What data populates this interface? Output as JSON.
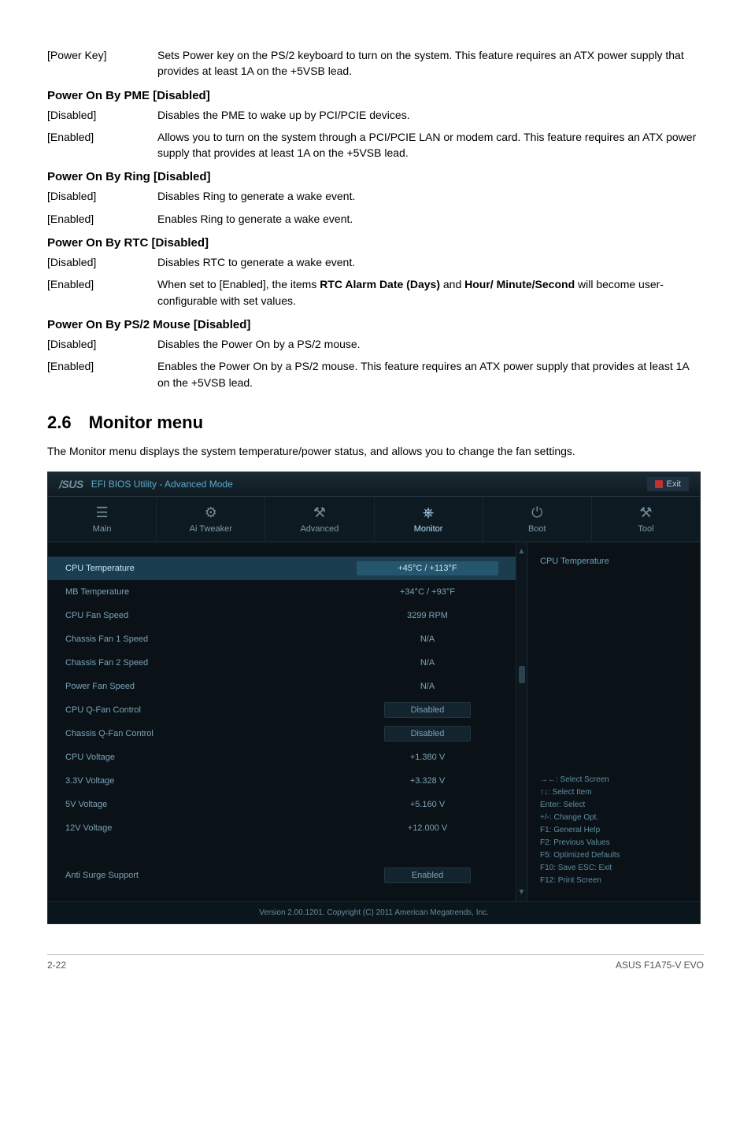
{
  "top_rows": [
    {
      "key": "[Power Key]",
      "desc": "Sets Power key on the PS/2 keyboard to turn on the system. This feature requires an ATX power supply that provides at least 1A on the +5VSB lead."
    }
  ],
  "sections": [
    {
      "heading": "Power On By PME [Disabled]",
      "rows": [
        {
          "key": "[Disabled]",
          "desc": "Disables the PME to wake up by PCI/PCIE devices."
        },
        {
          "key": "[Enabled]",
          "desc": "Allows you to turn on the system through a PCI/PCIE LAN or modem card. This feature requires an ATX power supply that provides at least 1A on the +5VSB lead."
        }
      ]
    },
    {
      "heading": "Power On By Ring [Disabled]",
      "rows": [
        {
          "key": "[Disabled]",
          "desc": "Disables Ring to generate a wake event."
        },
        {
          "key": "[Enabled]",
          "desc": "Enables Ring to generate a wake event."
        }
      ]
    },
    {
      "heading": "Power On By RTC [Disabled]",
      "rows": [
        {
          "key": "[Disabled]",
          "desc": "Disables RTC to generate a wake event."
        },
        {
          "key": "[Enabled]",
          "desc_html": "When set to [Enabled], the items <b>RTC Alarm Date (Days)</b> and <b>Hour/ Minute/Second</b> will become user-configurable with set values."
        }
      ]
    },
    {
      "heading": "Power On By PS/2 Mouse [Disabled]",
      "rows": [
        {
          "key": "[Disabled]",
          "desc": "Disables the Power On by a PS/2 mouse."
        },
        {
          "key": "[Enabled]",
          "desc": "Enables the Power On by a PS/2 mouse. This feature requires an ATX power supply that provides at least 1A on the +5VSB lead."
        }
      ]
    }
  ],
  "monitor_section": {
    "title": "2.6 Monitor menu",
    "desc": "The Monitor menu displays the system temperature/power status, and allows you to change the fan settings."
  },
  "bios": {
    "brand": "/SUS",
    "title": "EFI BIOS Utility - Advanced Mode",
    "exit": "Exit",
    "tabs": [
      {
        "icon": "☰",
        "label": "Main"
      },
      {
        "icon": "⚙",
        "label": "Ai Tweaker"
      },
      {
        "icon": "⚒",
        "label": "Advanced"
      },
      {
        "icon": "⎈",
        "label": "Monitor",
        "active": true
      },
      {
        "icon": "⏻",
        "label": "Boot"
      },
      {
        "icon": "⚒",
        "label": "Tool"
      }
    ],
    "settings": [
      {
        "label": "CPU Temperature",
        "value": "+45°C / +113°F",
        "selected": true
      },
      {
        "label": "MB Temperature",
        "value": "+34°C / +93°F"
      },
      {
        "label": "CPU Fan Speed",
        "value": "3299 RPM"
      },
      {
        "label": "Chassis Fan 1 Speed",
        "value": "N/A"
      },
      {
        "label": "Chassis Fan 2 Speed",
        "value": "N/A"
      },
      {
        "label": "Power Fan Speed",
        "value": "N/A"
      },
      {
        "label": "CPU Q-Fan Control",
        "value": "Disabled",
        "boxed": true
      },
      {
        "label": "Chassis Q-Fan Control",
        "value": "Disabled",
        "boxed": true
      },
      {
        "label": "CPU Voltage",
        "value": "+1.380 V"
      },
      {
        "label": "3.3V Voltage",
        "value": "+3.328 V"
      },
      {
        "label": "5V Voltage",
        "value": "+5.160 V"
      },
      {
        "label": "12V Voltage",
        "value": "+12.000 V"
      },
      {
        "label": "",
        "value": ""
      },
      {
        "label": "Anti Surge Support",
        "value": "Enabled",
        "boxed": true
      }
    ],
    "help_title": "CPU Temperature",
    "help_keys": [
      "→←: Select Screen",
      "↑↓: Select Item",
      "Enter: Select",
      "+/-: Change Opt.",
      "F1: General Help",
      "F2: Previous Values",
      "F5: Optimized Defaults",
      "F10: Save   ESC: Exit",
      "F12: Print Screen"
    ],
    "footer": "Version 2.00.1201.  Copyright (C) 2011 American Megatrends, Inc."
  },
  "page_footer": {
    "left": "2-22",
    "right": "ASUS F1A75-V EVO"
  }
}
